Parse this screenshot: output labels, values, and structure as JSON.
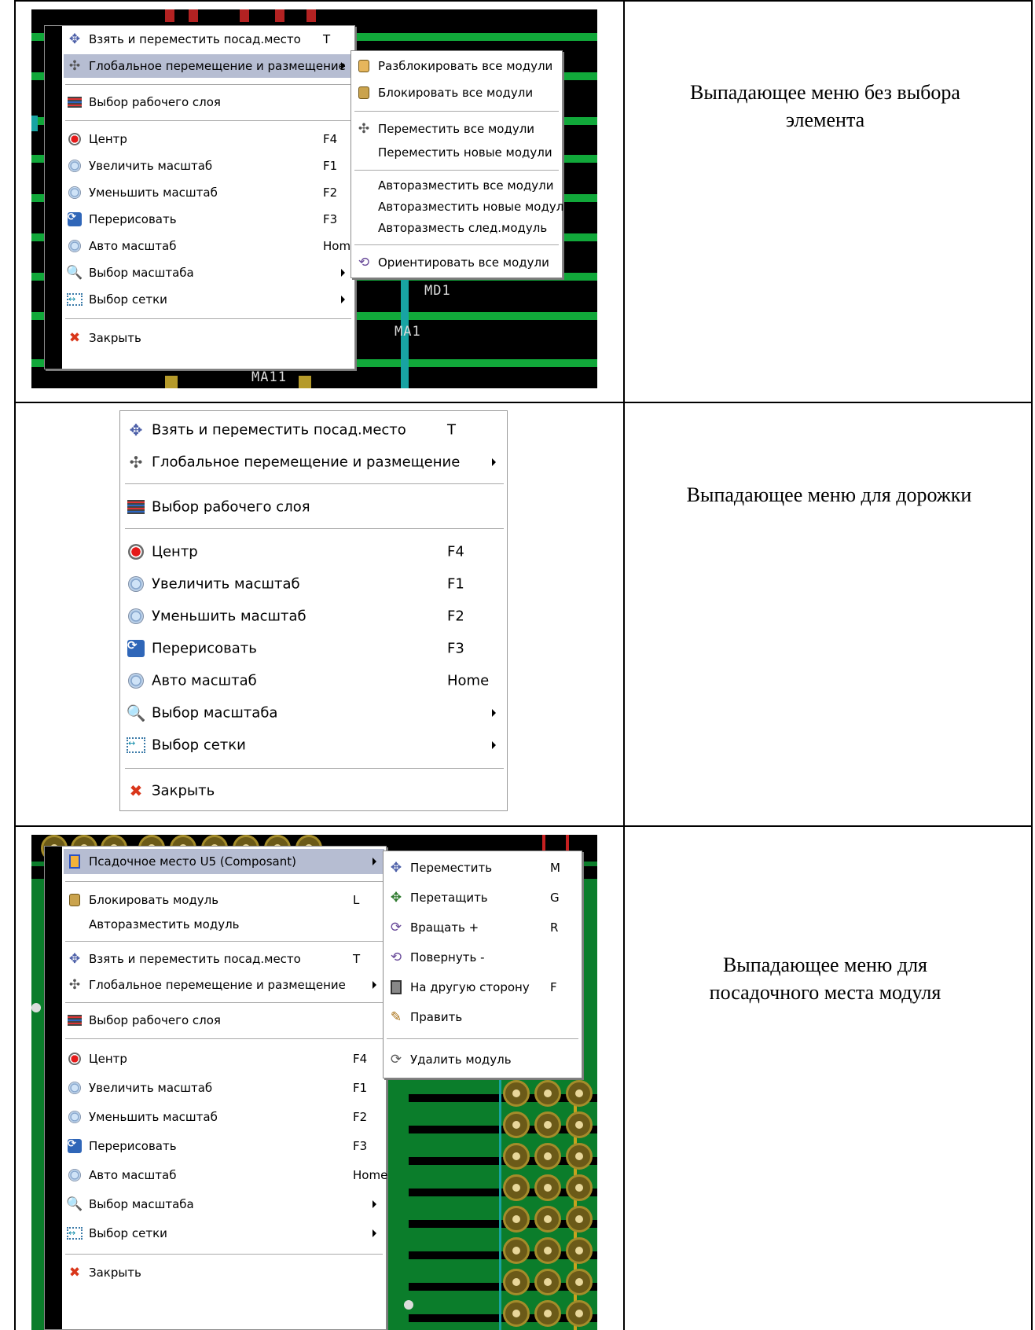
{
  "captions": {
    "row1": "Выпадающее меню без выбора элемента",
    "row2": "Выпадающее меню для дорожки",
    "row3": "Выпадающее меню для посадочного места модуля"
  },
  "silk": {
    "row1_md1": "MD1",
    "row1_ma1": "MA1",
    "row1_ma11": "MA11"
  },
  "menu_main": {
    "items": [
      {
        "icon": "move-footprint-icon",
        "label": "Взять и переместить посад.место",
        "shortcut": "T"
      },
      {
        "icon": "global-move-icon",
        "label": "Глобальное перемещение и размещение",
        "submenu": true
      },
      {
        "icon": "layers-icon",
        "label": "Выбор рабочего слоя"
      },
      {
        "icon": "center-icon",
        "label": "Центр",
        "shortcut": "F4"
      },
      {
        "icon": "zoom-in-icon",
        "label": "Увеличить масштаб",
        "shortcut": "F1"
      },
      {
        "icon": "zoom-out-icon",
        "label": "Уменьшить масштаб",
        "shortcut": "F2"
      },
      {
        "icon": "redraw-icon",
        "label": "Перерисовать",
        "shortcut": "F3"
      },
      {
        "icon": "auto-zoom-icon",
        "label": "Авто масштаб",
        "shortcut": "Home"
      },
      {
        "icon": "zoom-select-icon",
        "label": "Выбор масштаба",
        "submenu": true
      },
      {
        "icon": "grid-select-icon",
        "label": "Выбор сетки",
        "submenu": true
      },
      {
        "icon": "close-icon",
        "label": "Закрыть"
      }
    ]
  },
  "submenu_global": {
    "items": [
      {
        "icon": "unlock-icon",
        "label": "Разблокировать все модули"
      },
      {
        "icon": "lock-icon",
        "label": "Блокировать все модули"
      },
      {
        "icon": "move-all-icon",
        "label": "Переместить все модули"
      },
      {
        "label": "Переместить новые модули"
      },
      {
        "label": "Авторазместить все модули"
      },
      {
        "label": "Авторазместить новые модули"
      },
      {
        "label": "Авторазместь след.модуль"
      },
      {
        "icon": "orient-icon",
        "label": "Ориентировать все модули"
      }
    ]
  },
  "menu_track": {
    "items": [
      {
        "label": "Взять и переместить посад.место",
        "shortcut": "T"
      },
      {
        "label": "Глобальное перемещение и размещение"
      },
      {
        "label": "Выбор рабочего слоя"
      },
      {
        "label": "Центр",
        "shortcut": "F4"
      },
      {
        "label": "Увеличить масштаб",
        "shortcut": "F1"
      },
      {
        "label": "Уменьшить масштаб",
        "shortcut": "F2"
      },
      {
        "label": "Перерисовать",
        "shortcut": "F3"
      },
      {
        "label": "Авто масштаб",
        "shortcut": "Home"
      },
      {
        "label": "Выбор масштаба"
      },
      {
        "label": "Выбор сетки"
      },
      {
        "label": "Закрыть"
      }
    ]
  },
  "menu_module": {
    "items": [
      {
        "label": "Псадочное место U5 (Composant)"
      },
      {
        "label": "Блокировать модуль",
        "shortcut": "L"
      },
      {
        "label": "Авторазместить модуль"
      },
      {
        "label": "Взять и переместить посад.место",
        "shortcut": "T"
      },
      {
        "label": "Глобальное перемещение и размещение"
      },
      {
        "label": "Выбор рабочего слоя"
      },
      {
        "label": "Центр",
        "shortcut": "F4"
      },
      {
        "label": "Увеличить масштаб",
        "shortcut": "F1"
      },
      {
        "label": "Уменьшить масштаб",
        "shortcut": "F2"
      },
      {
        "label": "Перерисовать",
        "shortcut": "F3"
      },
      {
        "label": "Авто масштаб",
        "shortcut": "Home"
      },
      {
        "label": "Выбор масштаба"
      },
      {
        "label": "Выбор сетки"
      },
      {
        "label": "Закрыть"
      }
    ]
  },
  "submenu_footprint": {
    "items": [
      {
        "label": "Переместить",
        "shortcut": "M"
      },
      {
        "label": "Перетащить",
        "shortcut": "G"
      },
      {
        "label": "Вращать +",
        "shortcut": "R"
      },
      {
        "label": "Повернуть -"
      },
      {
        "label": "На другую сторону",
        "shortcut": "F"
      },
      {
        "label": "Править"
      },
      {
        "label": "Удалить модуль"
      }
    ]
  }
}
